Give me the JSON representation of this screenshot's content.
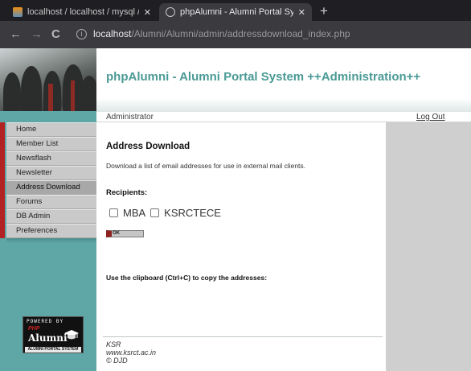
{
  "browser": {
    "tabs": [
      {
        "label": "localhost / localhost / mysql / us",
        "active": false
      },
      {
        "label": "phpAlumni - Alumni Portal Syste",
        "active": true
      }
    ],
    "url_host": "localhost",
    "url_path": "/Alumni/Alumni/admin/addressdownload_index.php"
  },
  "header": {
    "site_title": "phpAlumni - Alumni Portal System ++Administration++"
  },
  "userbar": {
    "role": "Administrator",
    "logout_label": "Log Out"
  },
  "menu": {
    "items": [
      {
        "label": "Home"
      },
      {
        "label": "Member List"
      },
      {
        "label": "Newsflash"
      },
      {
        "label": "Newsletter"
      },
      {
        "label": "Address Download",
        "active": true
      },
      {
        "label": "Forums"
      },
      {
        "label": "DB Admin"
      },
      {
        "label": "Preferences"
      }
    ]
  },
  "main": {
    "heading": "Address Download",
    "description": "Download a list of email addresses for use in external mail clients.",
    "recipients_label": "Recipients:",
    "recipients": [
      {
        "label": "MBA",
        "checked": false
      },
      {
        "label": "KSRCTECE",
        "checked": false
      }
    ],
    "ok_label": "OK",
    "clipboard_label": "Use the clipboard (Ctrl+C) to copy the addresses:"
  },
  "footer": {
    "line1": "KSR",
    "line2": "www.ksrct.ac.in",
    "line3": "© DJD"
  },
  "logo": {
    "powered": "POWERED BY",
    "php": "PHP",
    "alumni": "Alumni",
    "tagline": "ALUMNI PORTAL SYSTEM"
  },
  "colors": {
    "accent_teal": "#5fa7a7",
    "title_teal": "#4b9a96",
    "menu_marker_red": "#b32222"
  }
}
